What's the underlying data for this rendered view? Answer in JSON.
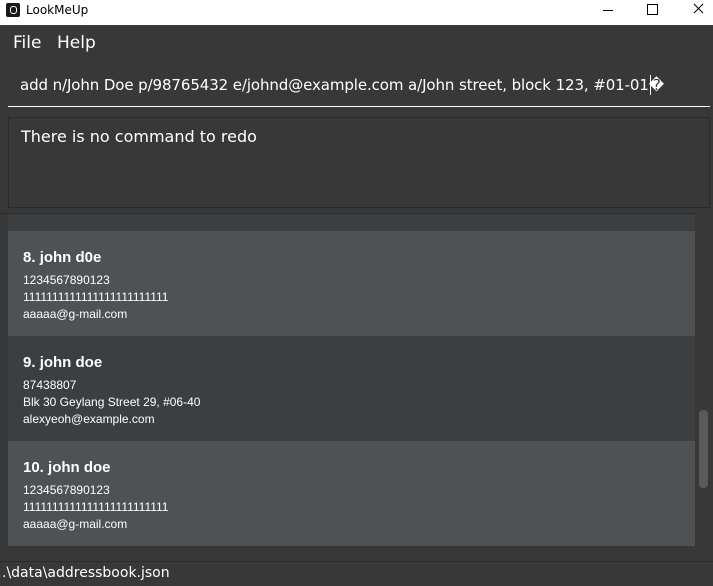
{
  "window": {
    "title": "LookMeUp"
  },
  "menu": {
    "file": "File",
    "help": "Help"
  },
  "command": {
    "value": "add n/John Doe p/98765432 e/johnd@example.com a/John street, block 123, #01-01�"
  },
  "result": {
    "text": "There is no command to redo"
  },
  "persons": [
    {
      "index": "8.",
      "name": "john d0e",
      "phone": "1234567890123",
      "address": "1111111111111111111111111",
      "email": "aaaaa@g-mail.com"
    },
    {
      "index": "9.",
      "name": "john doe",
      "phone": "87438807",
      "address": "Blk 30 Geylang Street 29, #06-40",
      "email": "alexyeoh@example.com"
    },
    {
      "index": "10.",
      "name": "john doe",
      "phone": "1234567890123",
      "address": "1111111111111111111111111",
      "email": "aaaaa@g-mail.com"
    }
  ],
  "status": {
    "path": ".\\data\\addressbook.json"
  }
}
